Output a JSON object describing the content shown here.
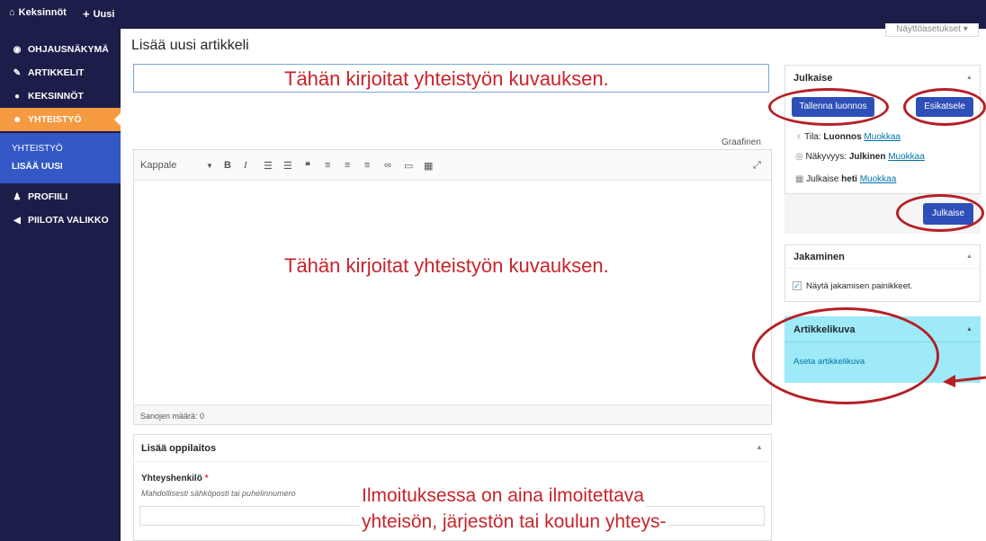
{
  "adminbar": {
    "site_name": "Keksinnöt",
    "new_label": "Uusi"
  },
  "menu": {
    "items": [
      {
        "label": "OHJAUSNÄKYMÄ",
        "icon": "dashboard-icon"
      },
      {
        "label": "ARTIKKELIT",
        "icon": "pin-icon"
      },
      {
        "label": "KEKSINNÖT",
        "icon": "lightbulb-icon"
      },
      {
        "label": "YHTEISTYÖ",
        "icon": "people-icon"
      },
      {
        "label": "PROFIILI",
        "icon": "user-icon"
      },
      {
        "label": "PIILOTA VALIKKO",
        "icon": "collapse-icon"
      }
    ],
    "submenu": [
      "YHTEISTYÖ",
      "LISÄÄ UUSI"
    ]
  },
  "main": {
    "page_title": "Lisää uusi artikkeli",
    "screen_options": "Näyttöasetukset ▾",
    "title_overlay": "Tähän kirjoitat yhteistyön kuvauksen.",
    "editor_overlay": "Tähän kirjoitat yhteistyön kuvauksen.",
    "tab_visual": "Graafinen",
    "format_select": "Kappale",
    "word_count": "Sanojen määrä: 0",
    "metabox": {
      "title": "Lisää oppilaitos",
      "field_label": "Yhteyshenkilö",
      "required_mark": "*",
      "field_hint": "Mahdollisesti sähköposti tai puhelinnumero"
    },
    "bottom_overlay_line1": "Ilmoituksessa on aina ilmoitettava",
    "bottom_overlay_line2": "yhteisön, järjestön tai koulun yhteys-"
  },
  "publish": {
    "title": "Julkaise",
    "save_draft": "Tallenna luonnos",
    "preview": "Esikatsele",
    "status_label": "Tila:",
    "status_value": "Luonnos",
    "visibility_label": "Näkyvyys:",
    "visibility_value": "Julkinen",
    "publish_label": "Julkaise",
    "publish_value": "heti",
    "edit_link": "Muokkaa",
    "publish_button": "Julkaise"
  },
  "sharing": {
    "title": "Jakaminen",
    "checkbox_label": "Näytä jakamisen painikkeet.",
    "checked": true
  },
  "featured": {
    "title": "Artikkelikuva",
    "set_link": "Aseta artikkelikuva",
    "highlight_color": "#9eeaf9"
  },
  "colors": {
    "adminbar": "#1d1d4a",
    "accent_orange": "#f59a40",
    "submenu_blue": "#3358c5",
    "button_blue": "#2e4fb7",
    "annotation_red": "#c8242b"
  }
}
